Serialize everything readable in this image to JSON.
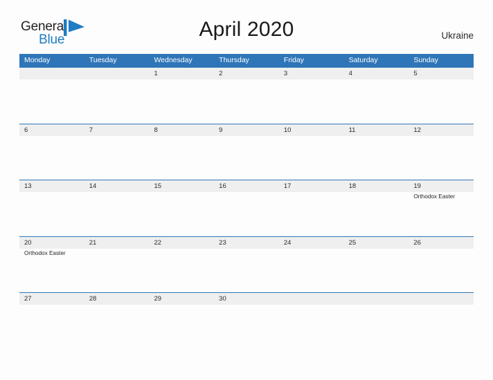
{
  "brand": {
    "name_part1": "General",
    "name_part2": "Blue",
    "mark_icon": "flag-triangle-icon",
    "accent_color": "#1d7cc4"
  },
  "header": {
    "title": "April 2020",
    "country": "Ukraine"
  },
  "theme": {
    "header_blue": "#2f76b8",
    "band_gray": "#efefef",
    "page_background": "#fdfdfd",
    "text_dark": "#2b2b2b"
  },
  "calendar": {
    "month": "April",
    "year": "2020",
    "weekday_headers": [
      "Monday",
      "Tuesday",
      "Wednesday",
      "Thursday",
      "Friday",
      "Saturday",
      "Sunday"
    ],
    "weeks": [
      [
        {
          "day": "",
          "event": ""
        },
        {
          "day": "",
          "event": ""
        },
        {
          "day": "1",
          "event": ""
        },
        {
          "day": "2",
          "event": ""
        },
        {
          "day": "3",
          "event": ""
        },
        {
          "day": "4",
          "event": ""
        },
        {
          "day": "5",
          "event": ""
        }
      ],
      [
        {
          "day": "6",
          "event": ""
        },
        {
          "day": "7",
          "event": ""
        },
        {
          "day": "8",
          "event": ""
        },
        {
          "day": "9",
          "event": ""
        },
        {
          "day": "10",
          "event": ""
        },
        {
          "day": "11",
          "event": ""
        },
        {
          "day": "12",
          "event": ""
        }
      ],
      [
        {
          "day": "13",
          "event": ""
        },
        {
          "day": "14",
          "event": ""
        },
        {
          "day": "15",
          "event": ""
        },
        {
          "day": "16",
          "event": ""
        },
        {
          "day": "17",
          "event": ""
        },
        {
          "day": "18",
          "event": ""
        },
        {
          "day": "19",
          "event": "Orthodox Easter"
        }
      ],
      [
        {
          "day": "20",
          "event": "Orthodox Easter"
        },
        {
          "day": "21",
          "event": ""
        },
        {
          "day": "22",
          "event": ""
        },
        {
          "day": "23",
          "event": ""
        },
        {
          "day": "24",
          "event": ""
        },
        {
          "day": "25",
          "event": ""
        },
        {
          "day": "26",
          "event": ""
        }
      ],
      [
        {
          "day": "27",
          "event": ""
        },
        {
          "day": "28",
          "event": ""
        },
        {
          "day": "29",
          "event": ""
        },
        {
          "day": "30",
          "event": ""
        },
        {
          "day": "",
          "event": ""
        },
        {
          "day": "",
          "event": ""
        },
        {
          "day": "",
          "event": ""
        }
      ]
    ]
  }
}
